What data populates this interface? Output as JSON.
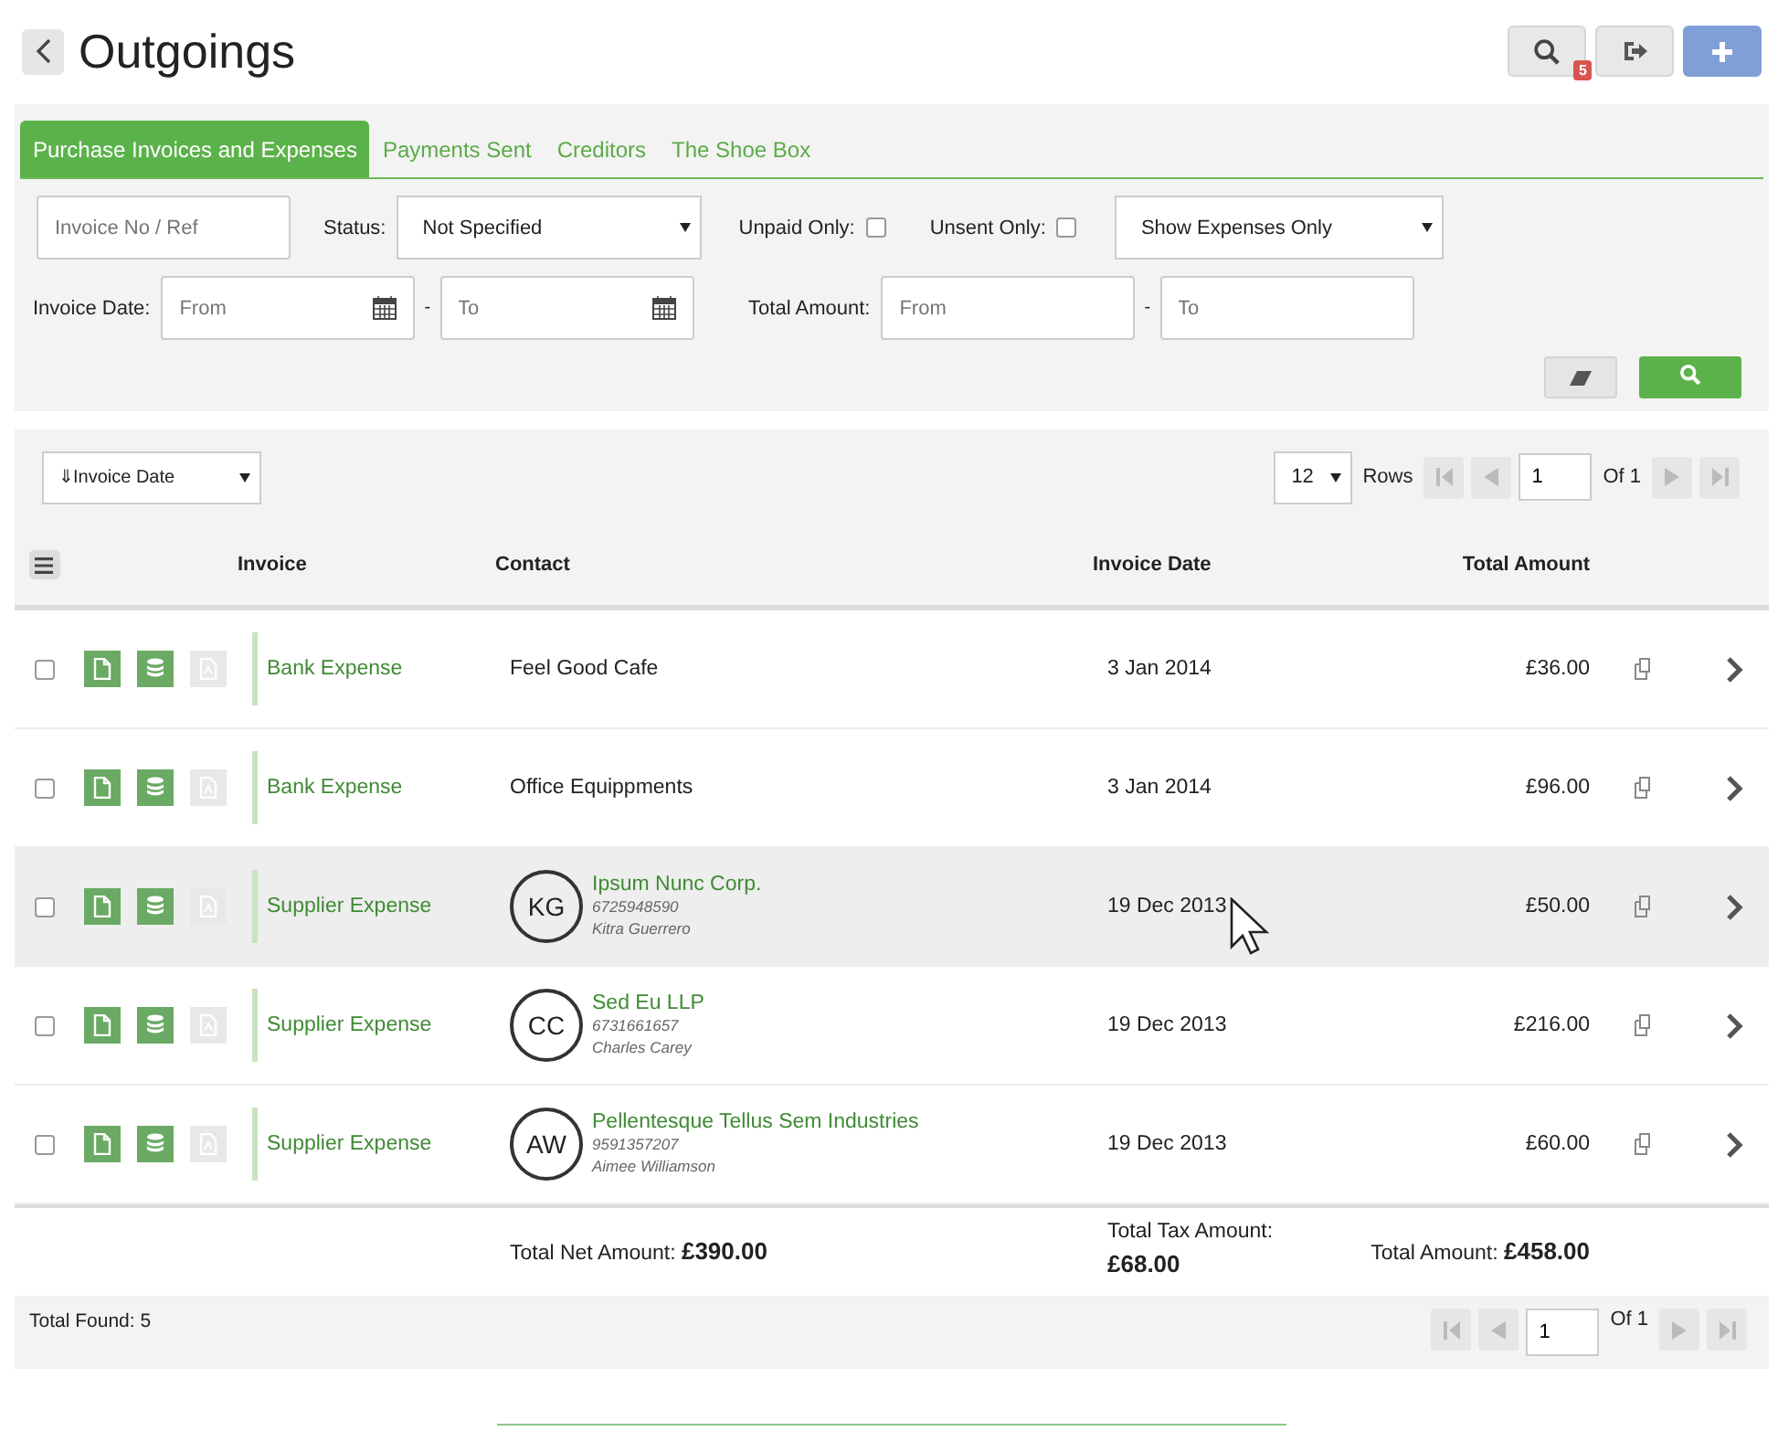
{
  "page": {
    "title": "Outgoings",
    "search_badge": "5"
  },
  "tabs": [
    {
      "label": "Purchase Invoices and Expenses",
      "selected": true
    },
    {
      "label": "Payments Sent",
      "selected": false
    },
    {
      "label": "Creditors",
      "selected": false
    },
    {
      "label": "The Shoe Box",
      "selected": false
    }
  ],
  "filters": {
    "invoice_placeholder": "Invoice No / Ref",
    "status_label": "Status:",
    "status_value": "Not Specified",
    "unpaid_label": "Unpaid Only:",
    "unpaid_checked": false,
    "unsent_label": "Unsent Only:",
    "unsent_checked": false,
    "expenses_value": "Show Expenses Only",
    "date_label": "Invoice Date:",
    "date_from_placeholder": "From",
    "date_to_placeholder": "To",
    "date_sep": "-",
    "amount_label": "Total Amount:",
    "amount_from_placeholder": "From",
    "amount_to_placeholder": "To",
    "amount_sep": "-"
  },
  "toolbar": {
    "sort_value": "⇓Invoice Date",
    "rows_value": "12",
    "rows_label": "Rows",
    "page_value": "1",
    "page_of": "Of 1"
  },
  "table": {
    "columns": [
      "Invoice",
      "Contact",
      "Invoice Date",
      "Total Amount"
    ],
    "rows": [
      {
        "checked": false,
        "selected": false,
        "invoice": "Bank Expense",
        "contact": "Feel Good Cafe",
        "date": "3 Jan 2014",
        "amount": "£36.00"
      },
      {
        "checked": false,
        "selected": false,
        "invoice": "Bank Expense",
        "contact": "Office Equippments",
        "date": "3 Jan 2014",
        "amount": "£96.00"
      },
      {
        "checked": false,
        "selected": true,
        "invoice": "Supplier Expense",
        "initials": "KG",
        "contact": "Ipsum Nunc Corp.",
        "phone": "6725948590",
        "person": "Kitra Guerrero",
        "date": "19 Dec 2013",
        "amount": "£50.00"
      },
      {
        "checked": false,
        "selected": false,
        "invoice": "Supplier Expense",
        "initials": "CC",
        "contact": "Sed Eu LLP",
        "phone": "6731661657",
        "person": "Charles Carey",
        "date": "19 Dec 2013",
        "amount": "£216.00"
      },
      {
        "checked": false,
        "selected": false,
        "invoice": "Supplier Expense",
        "initials": "AW",
        "contact": "Pellentesque Tellus Sem Industries",
        "phone": "9591357207",
        "person": "Aimee Williamson",
        "date": "19 Dec 2013",
        "amount": "£60.00"
      }
    ]
  },
  "totals": {
    "net_label": "Total Net Amount:",
    "net_value": "£390.00",
    "tax_label": "Total Tax Amount:",
    "tax_value": "£68.00",
    "total_label": "Total Amount:",
    "total_value": "£458.00"
  },
  "footer": {
    "found_label": "Total Found:",
    "found_value": "5",
    "page_value": "1",
    "page_of": "Of 1"
  }
}
